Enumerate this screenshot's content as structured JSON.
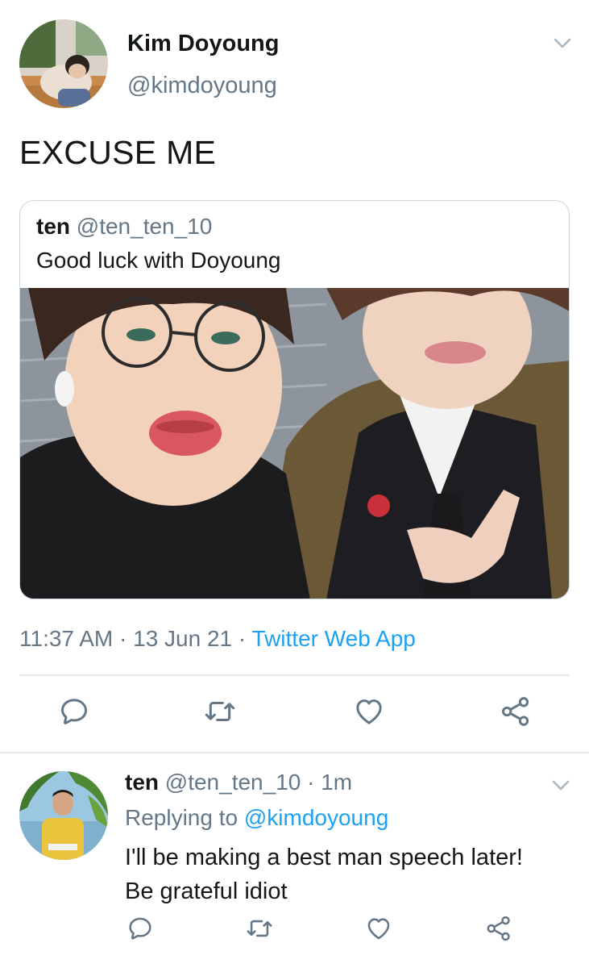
{
  "main_tweet": {
    "author_name": "Kim Doyoung",
    "author_handle": "@kimdoyoung",
    "text": "EXCUSE ME",
    "quoted": {
      "name": "ten",
      "handle": "@ten_ten_10",
      "text": "Good luck with Doyoung"
    },
    "time": "11:37 AM",
    "date": "13 Jun 21",
    "separator": "·",
    "source": "Twitter Web App"
  },
  "reply_tweet": {
    "author_name": "ten",
    "author_handle": "@ten_ten_10",
    "separator": "·",
    "relative_time": "1m",
    "replying_prefix": "Replying to",
    "replying_mention": "@kimdoyoung",
    "text_line1": "I'll be making a best man speech later!",
    "text_line2": "Be grateful idiot"
  },
  "icons": {
    "reply": "reply-icon",
    "retweet": "retweet-icon",
    "like": "heart-icon",
    "share": "share-icon",
    "menu": "chevron-down-icon"
  },
  "colors": {
    "text_primary": "#14171a",
    "text_secondary": "#657786",
    "link": "#1da1f2",
    "icon": "#657786",
    "border": "#ccd6dd"
  }
}
